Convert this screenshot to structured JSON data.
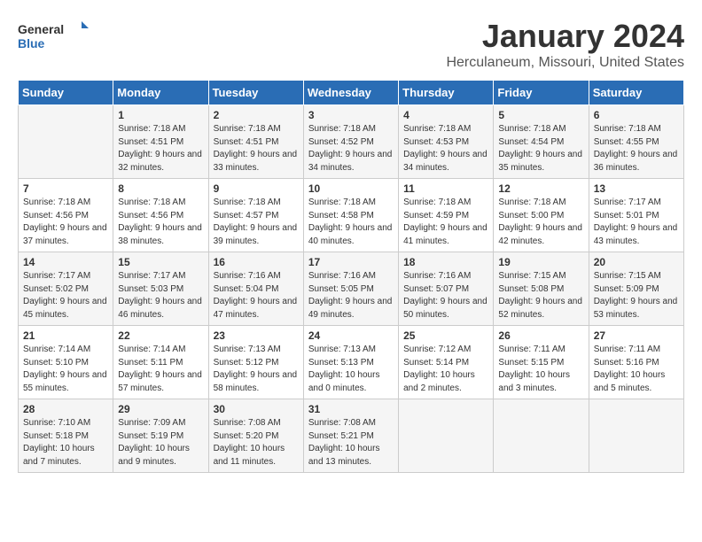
{
  "header": {
    "logo_line1": "General",
    "logo_line2": "Blue",
    "title": "January 2024",
    "subtitle": "Herculaneum, Missouri, United States"
  },
  "days_of_week": [
    "Sunday",
    "Monday",
    "Tuesday",
    "Wednesday",
    "Thursday",
    "Friday",
    "Saturday"
  ],
  "weeks": [
    [
      {
        "day": "",
        "sunrise": "",
        "sunset": "",
        "daylight": ""
      },
      {
        "day": "1",
        "sunrise": "Sunrise: 7:18 AM",
        "sunset": "Sunset: 4:51 PM",
        "daylight": "Daylight: 9 hours and 32 minutes."
      },
      {
        "day": "2",
        "sunrise": "Sunrise: 7:18 AM",
        "sunset": "Sunset: 4:51 PM",
        "daylight": "Daylight: 9 hours and 33 minutes."
      },
      {
        "day": "3",
        "sunrise": "Sunrise: 7:18 AM",
        "sunset": "Sunset: 4:52 PM",
        "daylight": "Daylight: 9 hours and 34 minutes."
      },
      {
        "day": "4",
        "sunrise": "Sunrise: 7:18 AM",
        "sunset": "Sunset: 4:53 PM",
        "daylight": "Daylight: 9 hours and 34 minutes."
      },
      {
        "day": "5",
        "sunrise": "Sunrise: 7:18 AM",
        "sunset": "Sunset: 4:54 PM",
        "daylight": "Daylight: 9 hours and 35 minutes."
      },
      {
        "day": "6",
        "sunrise": "Sunrise: 7:18 AM",
        "sunset": "Sunset: 4:55 PM",
        "daylight": "Daylight: 9 hours and 36 minutes."
      }
    ],
    [
      {
        "day": "7",
        "sunrise": "Sunrise: 7:18 AM",
        "sunset": "Sunset: 4:56 PM",
        "daylight": "Daylight: 9 hours and 37 minutes."
      },
      {
        "day": "8",
        "sunrise": "Sunrise: 7:18 AM",
        "sunset": "Sunset: 4:56 PM",
        "daylight": "Daylight: 9 hours and 38 minutes."
      },
      {
        "day": "9",
        "sunrise": "Sunrise: 7:18 AM",
        "sunset": "Sunset: 4:57 PM",
        "daylight": "Daylight: 9 hours and 39 minutes."
      },
      {
        "day": "10",
        "sunrise": "Sunrise: 7:18 AM",
        "sunset": "Sunset: 4:58 PM",
        "daylight": "Daylight: 9 hours and 40 minutes."
      },
      {
        "day": "11",
        "sunrise": "Sunrise: 7:18 AM",
        "sunset": "Sunset: 4:59 PM",
        "daylight": "Daylight: 9 hours and 41 minutes."
      },
      {
        "day": "12",
        "sunrise": "Sunrise: 7:18 AM",
        "sunset": "Sunset: 5:00 PM",
        "daylight": "Daylight: 9 hours and 42 minutes."
      },
      {
        "day": "13",
        "sunrise": "Sunrise: 7:17 AM",
        "sunset": "Sunset: 5:01 PM",
        "daylight": "Daylight: 9 hours and 43 minutes."
      }
    ],
    [
      {
        "day": "14",
        "sunrise": "Sunrise: 7:17 AM",
        "sunset": "Sunset: 5:02 PM",
        "daylight": "Daylight: 9 hours and 45 minutes."
      },
      {
        "day": "15",
        "sunrise": "Sunrise: 7:17 AM",
        "sunset": "Sunset: 5:03 PM",
        "daylight": "Daylight: 9 hours and 46 minutes."
      },
      {
        "day": "16",
        "sunrise": "Sunrise: 7:16 AM",
        "sunset": "Sunset: 5:04 PM",
        "daylight": "Daylight: 9 hours and 47 minutes."
      },
      {
        "day": "17",
        "sunrise": "Sunrise: 7:16 AM",
        "sunset": "Sunset: 5:05 PM",
        "daylight": "Daylight: 9 hours and 49 minutes."
      },
      {
        "day": "18",
        "sunrise": "Sunrise: 7:16 AM",
        "sunset": "Sunset: 5:07 PM",
        "daylight": "Daylight: 9 hours and 50 minutes."
      },
      {
        "day": "19",
        "sunrise": "Sunrise: 7:15 AM",
        "sunset": "Sunset: 5:08 PM",
        "daylight": "Daylight: 9 hours and 52 minutes."
      },
      {
        "day": "20",
        "sunrise": "Sunrise: 7:15 AM",
        "sunset": "Sunset: 5:09 PM",
        "daylight": "Daylight: 9 hours and 53 minutes."
      }
    ],
    [
      {
        "day": "21",
        "sunrise": "Sunrise: 7:14 AM",
        "sunset": "Sunset: 5:10 PM",
        "daylight": "Daylight: 9 hours and 55 minutes."
      },
      {
        "day": "22",
        "sunrise": "Sunrise: 7:14 AM",
        "sunset": "Sunset: 5:11 PM",
        "daylight": "Daylight: 9 hours and 57 minutes."
      },
      {
        "day": "23",
        "sunrise": "Sunrise: 7:13 AM",
        "sunset": "Sunset: 5:12 PM",
        "daylight": "Daylight: 9 hours and 58 minutes."
      },
      {
        "day": "24",
        "sunrise": "Sunrise: 7:13 AM",
        "sunset": "Sunset: 5:13 PM",
        "daylight": "Daylight: 10 hours and 0 minutes."
      },
      {
        "day": "25",
        "sunrise": "Sunrise: 7:12 AM",
        "sunset": "Sunset: 5:14 PM",
        "daylight": "Daylight: 10 hours and 2 minutes."
      },
      {
        "day": "26",
        "sunrise": "Sunrise: 7:11 AM",
        "sunset": "Sunset: 5:15 PM",
        "daylight": "Daylight: 10 hours and 3 minutes."
      },
      {
        "day": "27",
        "sunrise": "Sunrise: 7:11 AM",
        "sunset": "Sunset: 5:16 PM",
        "daylight": "Daylight: 10 hours and 5 minutes."
      }
    ],
    [
      {
        "day": "28",
        "sunrise": "Sunrise: 7:10 AM",
        "sunset": "Sunset: 5:18 PM",
        "daylight": "Daylight: 10 hours and 7 minutes."
      },
      {
        "day": "29",
        "sunrise": "Sunrise: 7:09 AM",
        "sunset": "Sunset: 5:19 PM",
        "daylight": "Daylight: 10 hours and 9 minutes."
      },
      {
        "day": "30",
        "sunrise": "Sunrise: 7:08 AM",
        "sunset": "Sunset: 5:20 PM",
        "daylight": "Daylight: 10 hours and 11 minutes."
      },
      {
        "day": "31",
        "sunrise": "Sunrise: 7:08 AM",
        "sunset": "Sunset: 5:21 PM",
        "daylight": "Daylight: 10 hours and 13 minutes."
      },
      {
        "day": "",
        "sunrise": "",
        "sunset": "",
        "daylight": ""
      },
      {
        "day": "",
        "sunrise": "",
        "sunset": "",
        "daylight": ""
      },
      {
        "day": "",
        "sunrise": "",
        "sunset": "",
        "daylight": ""
      }
    ]
  ]
}
